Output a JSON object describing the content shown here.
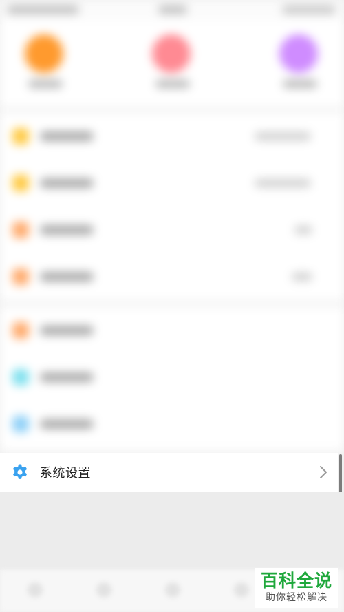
{
  "settings_row": {
    "label": "系统设置",
    "icon": "gear-icon",
    "icon_color": "#3aa2ef",
    "chevron": "chevron-right-icon"
  },
  "top_shortcuts": [
    {
      "color": "#ff9a2e"
    },
    {
      "color": "#ff8a93"
    },
    {
      "color": "#cf8cff"
    }
  ],
  "list_icons": [
    {
      "color": "#ffc940"
    },
    {
      "color": "#ffc940"
    },
    {
      "color": "#ffa96a"
    },
    {
      "color": "#ffa96a"
    },
    {
      "color": "#ffa96a"
    },
    {
      "color": "#7ee0ee"
    },
    {
      "color": "#8ccff7"
    }
  ],
  "watermark": {
    "title": "百科全说",
    "subtitle": "助你轻松解决",
    "color": "#1fa83c"
  }
}
